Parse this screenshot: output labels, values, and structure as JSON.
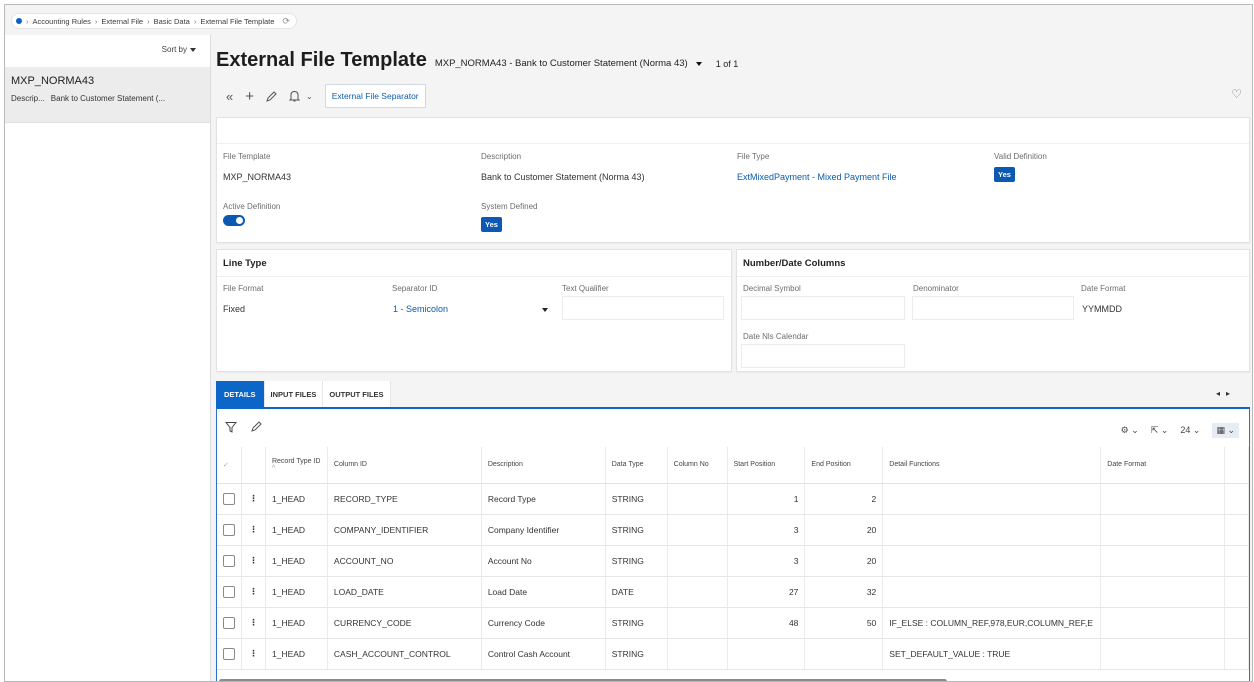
{
  "breadcrumb": [
    "Accounting Rules",
    "External File",
    "Basic Data",
    "External File Template"
  ],
  "left_panel": {
    "sort_label": "Sort by",
    "item": {
      "title": "MXP_NORMA43",
      "desc_label": "Descrip...",
      "desc_value": "Bank to Customer Statement (..."
    }
  },
  "header": {
    "title": "External File Template",
    "record": "MXP_NORMA43 - Bank to Customer Statement (Norma 43)",
    "pager": "1 of 1"
  },
  "toolbar": {
    "ext_button": "External File Separator"
  },
  "main_card": {
    "file_template_label": "File Template",
    "file_template": "MXP_NORMA43",
    "description_label": "Description",
    "description": "Bank to Customer Statement (Norma 43)",
    "file_type_label": "File Type",
    "file_type": "ExtMixedPayment - Mixed Payment File",
    "valid_def_label": "Valid Definition",
    "valid_def": "Yes",
    "active_def_label": "Active Definition",
    "active_def_on": true,
    "system_defined_label": "System Defined",
    "system_defined": "Yes"
  },
  "line_type": {
    "title": "Line Type",
    "file_format_label": "File Format",
    "file_format": "Fixed",
    "separator_label": "Separator ID",
    "separator": "1 - Semicolon",
    "text_qualifier_label": "Text Qualifier"
  },
  "number_date": {
    "title": "Number/Date Columns",
    "decimal_label": "Decimal Symbol",
    "denominator_label": "Denominator",
    "date_format_label": "Date Format",
    "date_format": "YYMMDD",
    "nls_label": "Date Nls Calendar"
  },
  "tabs": [
    "DETAILS",
    "INPUT FILES",
    "OUTPUT FILES"
  ],
  "grid": {
    "page_size": "24",
    "columns": [
      "Record Type ID",
      "Column ID",
      "Description",
      "Data Type",
      "Column No",
      "Start Position",
      "End Position",
      "Detail Functions",
      "Date Format"
    ],
    "rows": [
      {
        "rt": "1_HEAD",
        "col": "RECORD_TYPE",
        "desc": "Record Type",
        "type": "STRING",
        "no": "",
        "start": "1",
        "end": "2",
        "fn": "",
        "df": ""
      },
      {
        "rt": "1_HEAD",
        "col": "COMPANY_IDENTIFIER",
        "desc": "Company Identifier",
        "type": "STRING",
        "no": "",
        "start": "3",
        "end": "20",
        "fn": "",
        "df": ""
      },
      {
        "rt": "1_HEAD",
        "col": "ACCOUNT_NO",
        "desc": "Account No",
        "type": "STRING",
        "no": "",
        "start": "3",
        "end": "20",
        "fn": "",
        "df": ""
      },
      {
        "rt": "1_HEAD",
        "col": "LOAD_DATE",
        "desc": "Load Date",
        "type": "DATE",
        "no": "",
        "start": "27",
        "end": "32",
        "fn": "",
        "df": ""
      },
      {
        "rt": "1_HEAD",
        "col": "CURRENCY_CODE",
        "desc": "Currency Code",
        "type": "STRING",
        "no": "",
        "start": "48",
        "end": "50",
        "fn": "IF_ELSE : COLUMN_REF,978,EUR,COLUMN_REF,E",
        "df": ""
      },
      {
        "rt": "1_HEAD",
        "col": "CASH_ACCOUNT_CONTROL",
        "desc": "Control Cash Account",
        "type": "STRING",
        "no": "",
        "start": "",
        "end": "",
        "fn": "SET_DEFAULT_VALUE : TRUE",
        "df": ""
      }
    ]
  }
}
